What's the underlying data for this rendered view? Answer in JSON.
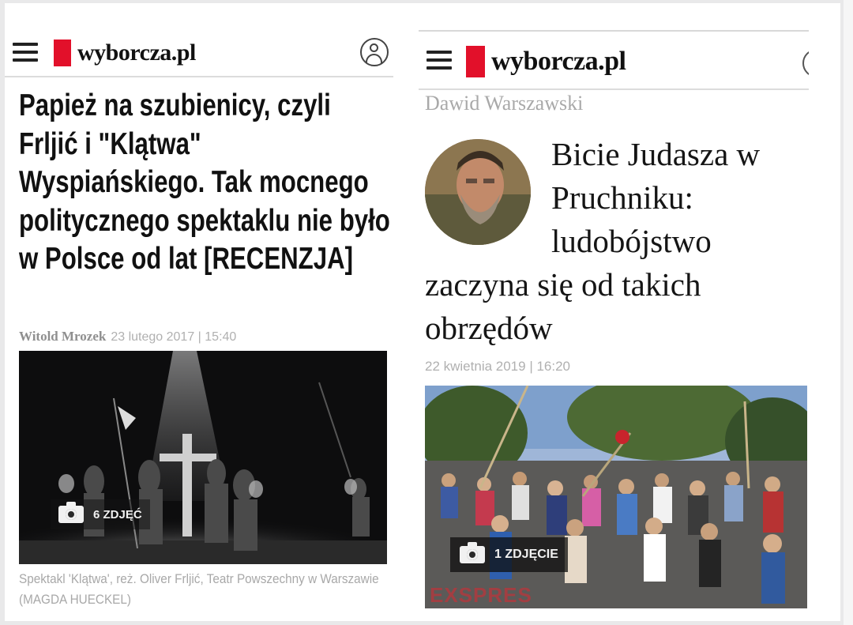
{
  "left": {
    "logo_text": "wyborcza.pl",
    "headline": "Papież na szubienicy, czyli Frljić i \"Klątwa\" Wyspiańskiego. Tak mocnego politycznego spektaklu nie było w Polsce od lat [RECENZJA]",
    "author": "Witold Mrozek",
    "date": "23 lutego 2017 | 15:40",
    "photo_badge": "6 ZDJĘĆ",
    "caption": "Spektakl 'Klątwa', reż. Oliver Frljić, Teatr Powszechny w Warszawie (MAGDA HUECKEL)"
  },
  "right": {
    "logo_text": "wyborcza.pl",
    "author": "Dawid Warszawski",
    "headline_first_lines": [
      "Bicie Judasza w",
      "Pruchniku:",
      "ludobójstwo"
    ],
    "headline_rest": [
      "zaczyna się od takich",
      "obrzędów"
    ],
    "date": "22 kwietnia 2019 | 16:20",
    "photo_badge": "1 ZDJĘCIE",
    "watermark": "EXSPRES"
  },
  "colors": {
    "brand_red": "#e2102a",
    "text_dark": "#111111",
    "meta_gray": "#a8a8a8"
  },
  "icons": [
    "menu-icon",
    "user-icon",
    "camera-icon"
  ]
}
